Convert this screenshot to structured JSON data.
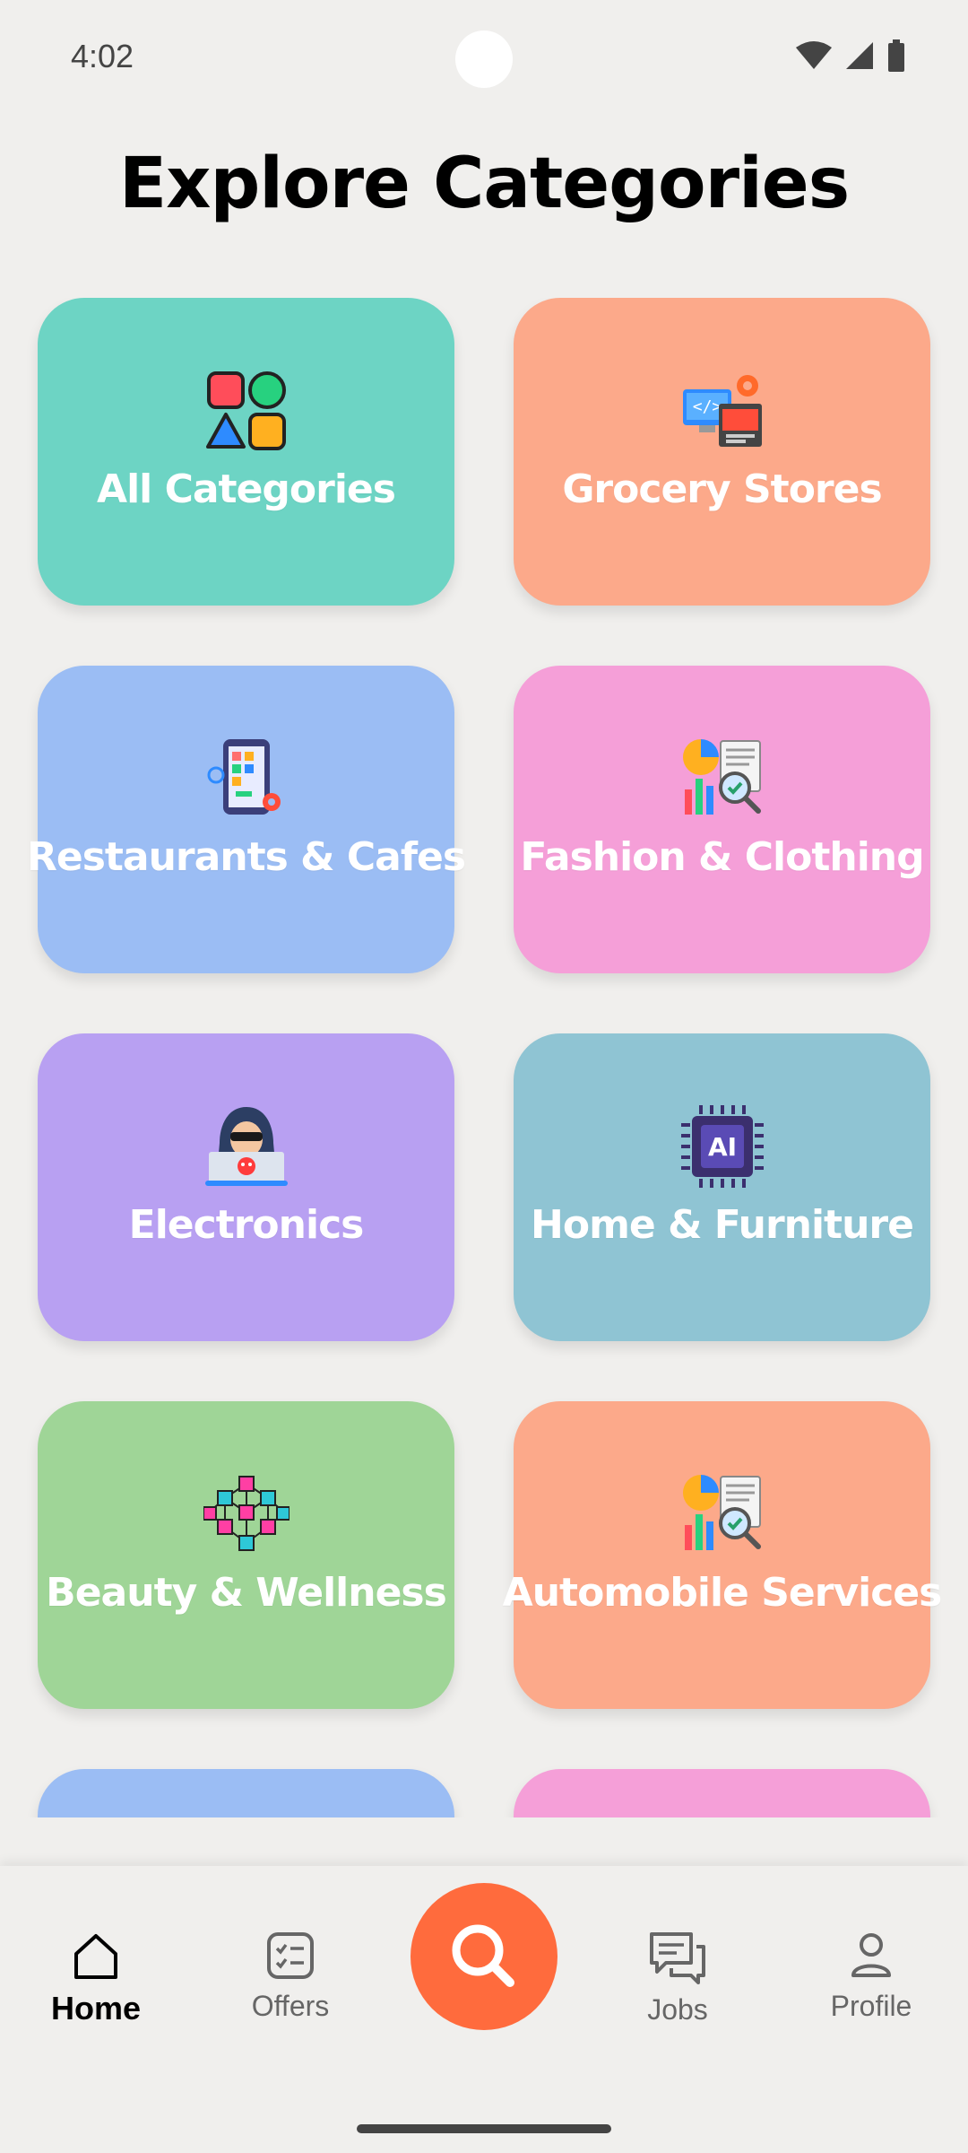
{
  "status_bar": {
    "time": "4:02"
  },
  "title": "Explore Categories",
  "categories": [
    {
      "label": "All Categories",
      "color": "#6dd4c4",
      "icon": "shapes-icon"
    },
    {
      "label": "Grocery Stores",
      "color": "#fca98a",
      "icon": "web-dev-icon"
    },
    {
      "label": "Restaurants & Cafes",
      "color": "#9bbdf4",
      "icon": "mobile-app-icon"
    },
    {
      "label": "Fashion & Clothing",
      "color": "#f59fd8",
      "icon": "analytics-icon"
    },
    {
      "label": "Electronics",
      "color": "#b8a0f2",
      "icon": "hacker-icon"
    },
    {
      "label": "Home & Furniture",
      "color": "#8fc4d3",
      "icon": "ai-chip-icon"
    },
    {
      "label": "Beauty & Wellness",
      "color": "#9fd597",
      "icon": "network-cubes-icon"
    },
    {
      "label": "Automobile Services",
      "color": "#fca98a",
      "icon": "analytics-icon"
    },
    {
      "label": "",
      "color": "#9bbdf4",
      "icon": ""
    },
    {
      "label": "",
      "color": "#f59fd8",
      "icon": ""
    }
  ],
  "nav": {
    "home": "Home",
    "offers": "Offers",
    "jobs": "Jobs",
    "profile": "Profile"
  },
  "colors": {
    "accent": "#ff6b3d",
    "background": "#f0efed"
  }
}
